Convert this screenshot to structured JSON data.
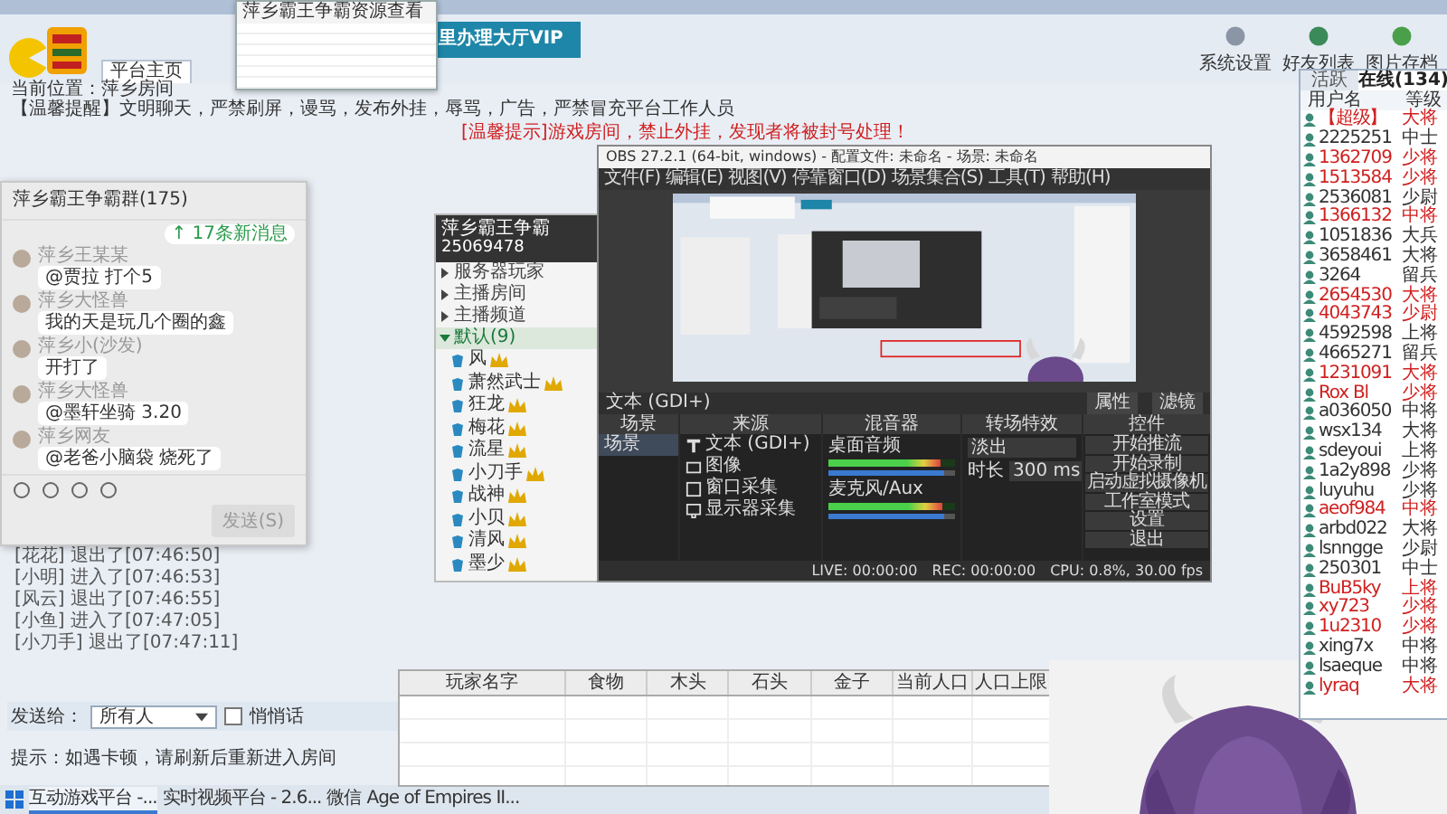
{
  "app": {
    "banner": "里办理大厅VIP",
    "home_tab": "平台主页",
    "location": "当前位置：萍乡房间",
    "notice": "【温馨提醒】文明聊天，严禁刷屏，谩骂，发布外挂，辱骂，广告，严禁冒充平台工作人员",
    "warning": "[温馨提示]游戏房间，禁止外挂，发现者将被封号处理！",
    "toolbar": [
      "系统设置",
      "好友列表",
      "图片存档"
    ]
  },
  "resource_dialog": {
    "title": "萍乡霸王争霸资源查看"
  },
  "user_panel": {
    "tabs": [
      {
        "label": "活跃",
        "selected": false
      },
      {
        "label": "在线(134)",
        "selected": true
      }
    ],
    "columns": [
      "用户名",
      "等级"
    ],
    "users": [
      {
        "name": "【超级】",
        "rank": "大将",
        "vip": true
      },
      {
        "name": "2225251",
        "rank": "中士",
        "vip": false
      },
      {
        "name": "1362709",
        "rank": "少将",
        "vip": true
      },
      {
        "name": "1513584",
        "rank": "少将",
        "vip": true
      },
      {
        "name": "2536081",
        "rank": "少尉",
        "vip": false
      },
      {
        "name": "1366132",
        "rank": "中将",
        "vip": true
      },
      {
        "name": "1051836",
        "rank": "大兵",
        "vip": false
      },
      {
        "name": "3658461",
        "rank": "大将",
        "vip": false
      },
      {
        "name": "3264",
        "rank": "留兵",
        "vip": false
      },
      {
        "name": "2654530",
        "rank": "大将",
        "vip": true
      },
      {
        "name": "4043743",
        "rank": "少尉",
        "vip": true
      },
      {
        "name": "4592598",
        "rank": "上将",
        "vip": false
      },
      {
        "name": "4665271",
        "rank": "留兵",
        "vip": false
      },
      {
        "name": "1231091",
        "rank": "大将",
        "vip": true
      },
      {
        "name": "Rox Bl",
        "rank": "少将",
        "vip": true
      },
      {
        "name": "a036050",
        "rank": "中将",
        "vip": false
      },
      {
        "name": "wsx134",
        "rank": "大将",
        "vip": false
      },
      {
        "name": "sdeyoui",
        "rank": "上将",
        "vip": false
      },
      {
        "name": "1a2y898",
        "rank": "少将",
        "vip": false
      },
      {
        "name": "luyuhu",
        "rank": "少将",
        "vip": false
      },
      {
        "name": "aeof984",
        "rank": "中将",
        "vip": true
      },
      {
        "name": "arbd022",
        "rank": "大将",
        "vip": false
      },
      {
        "name": "lsnngge",
        "rank": "少尉",
        "vip": false
      },
      {
        "name": "250301",
        "rank": "中士",
        "vip": false
      },
      {
        "name": "BuB5ky",
        "rank": "上将",
        "vip": true
      },
      {
        "name": "xy723",
        "rank": "少将",
        "vip": true
      },
      {
        "name": "1u2310",
        "rank": "少将",
        "vip": true
      },
      {
        "name": "xing7x",
        "rank": "中将",
        "vip": false
      },
      {
        "name": "lsaeque",
        "rank": "中将",
        "vip": false
      },
      {
        "name": "lyraq",
        "rank": "大将",
        "vip": true
      }
    ]
  },
  "chat": {
    "title": "萍乡霸王争霸群(175)",
    "new_messages": "↑ 17条新消息",
    "messages": [
      {
        "sender": "萍乡王某某",
        "text": "@贾拉 打个5"
      },
      {
        "sender": "萍乡大怪兽",
        "text": "我的天是玩几个圈的鑫"
      },
      {
        "sender": "萍乡小(沙发)",
        "text": "开打了"
      },
      {
        "sender": "萍乡大怪兽",
        "text": "@墨轩坐骑 3.20"
      },
      {
        "sender": "萍乡网友",
        "text": "@老爸小脑袋 烧死了"
      }
    ],
    "send": "发送(S)"
  },
  "log": [
    "[花花] 退出了[07:46:50]",
    "[小明] 进入了[07:46:53]",
    "[风云] 退出了[07:46:55]",
    "[小鱼] 进入了[07:47:05]",
    "[小刀手] 退出了[07:47:11]"
  ],
  "send_bar": {
    "label": "发送给：",
    "target": "所有人",
    "whisper": {
      "label": "悄悄话",
      "checked": false
    }
  },
  "tip": "提示：如遇卡顿，请刷新后重新进入房间",
  "taskbar": [
    {
      "label": "互动游戏平台 -...",
      "active": true
    },
    {
      "label": "实时视频平台 - 2.6...",
      "active": false
    },
    {
      "label": "微信",
      "active": false
    },
    {
      "label": "Age of Empires II...",
      "active": false
    }
  ],
  "group": {
    "title": "萍乡霸王争霸",
    "id": "25069478",
    "groups": [
      {
        "name": "服务器玩家",
        "expanded": false
      },
      {
        "name": "主播房间",
        "expanded": false
      },
      {
        "name": "主播频道",
        "expanded": false
      },
      {
        "name": "默认(9)",
        "expanded": true,
        "children": [
          {
            "name": "风"
          },
          {
            "name": "萧然武士"
          },
          {
            "name": "狂龙"
          },
          {
            "name": "梅花"
          },
          {
            "name": "流星"
          },
          {
            "name": "小刀手"
          },
          {
            "name": "战神"
          },
          {
            "name": "小贝"
          },
          {
            "name": "清风"
          },
          {
            "name": "墨少"
          }
        ]
      }
    ]
  },
  "obs": {
    "title": "OBS 27.2.1 (64-bit, windows) - 配置文件: 未命名 - 场景: 未命名",
    "menu": [
      "文件(F)",
      "编辑(E)",
      "视图(V)",
      "停靠窗口(D)",
      "场景集合(S)",
      "工具(T)",
      "帮助(H)"
    ],
    "source_bar": {
      "selected": "文本 (GDI+)",
      "buttons": [
        "属性",
        "滤镜"
      ]
    },
    "panels": [
      "场景",
      "来源",
      "混音器",
      "转场特效",
      "控件"
    ],
    "scenes": [
      "场景"
    ],
    "sources": [
      {
        "name": "文本 (GDI+)",
        "kind": "text"
      },
      {
        "name": "图像"
      },
      {
        "name": "窗口采集",
        "kind": "window"
      },
      {
        "name": "显示器采集",
        "kind": "monitor"
      }
    ],
    "mixer": [
      {
        "name": "桌面音频",
        "level": 0.88,
        "volume": {
          "level": 0.92
        }
      },
      {
        "name": "麦克风/Aux",
        "level": 0.9,
        "volume": {
          "level": 0.92
        }
      }
    ],
    "transition": {
      "type": "淡出",
      "duration_label": "时长",
      "duration": "300 ms"
    },
    "controls": [
      "开始推流",
      "开始录制",
      "启动虚拟摄像机",
      "工作室模式",
      "设置",
      "退出"
    ],
    "status": [
      "LIVE: 00:00:00",
      "REC: 00:00:00",
      "CPU: 0.8%, 30.00 fps"
    ]
  },
  "table": {
    "columns": [
      "玩家名字",
      "食物",
      "木头",
      "石头",
      "金子",
      "当前人口",
      "人口上限"
    ]
  }
}
